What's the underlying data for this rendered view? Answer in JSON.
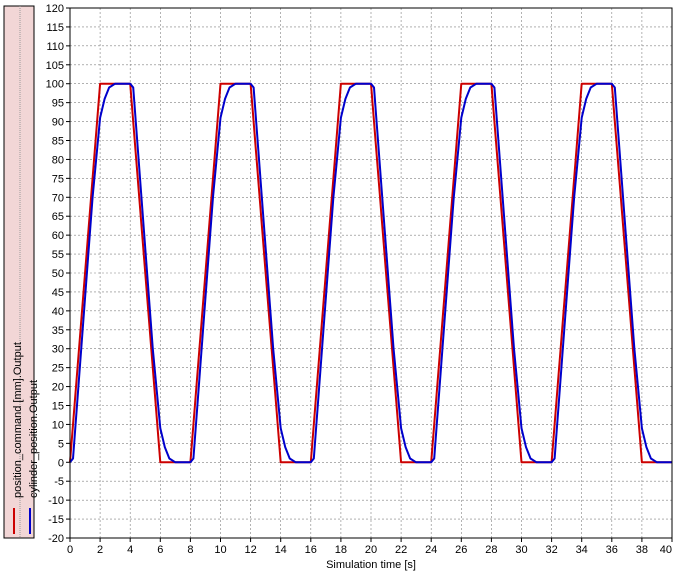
{
  "colors": {
    "legend_bg": "#f2d6d6",
    "plot_bg": "#ffffff",
    "grid": "#808080",
    "series_command": "#cc0000",
    "series_cylinder": "#0000cc"
  },
  "chart_data": {
    "type": "line",
    "title": "",
    "xlabel": "Simulation time [s]",
    "ylabel": "",
    "xlim": [
      0,
      40
    ],
    "ylim": [
      -20,
      120
    ],
    "x_ticks": [
      0,
      2,
      4,
      6,
      8,
      10,
      12,
      14,
      16,
      18,
      20,
      22,
      24,
      26,
      28,
      30,
      32,
      34,
      36,
      38,
      40
    ],
    "y_ticks": [
      -20,
      -15,
      -10,
      -5,
      0,
      5,
      10,
      15,
      20,
      25,
      30,
      35,
      40,
      45,
      50,
      55,
      60,
      65,
      70,
      75,
      80,
      85,
      90,
      95,
      100,
      105,
      110,
      115,
      120
    ],
    "grid": true,
    "legend_placement": "left-vertical",
    "series": [
      {
        "name": "position_command [mm].Output",
        "color": "#cc0000",
        "x": [
          0,
          2,
          4,
          6,
          8,
          10,
          12,
          14,
          16,
          18,
          20,
          22,
          24,
          26,
          28,
          30,
          32,
          34,
          36,
          38,
          40
        ],
        "y": [
          0,
          100,
          100,
          0,
          0,
          100,
          100,
          0,
          0,
          100,
          100,
          0,
          0,
          100,
          100,
          0,
          0,
          100,
          100,
          0,
          0
        ]
      },
      {
        "name": "cylinder_position.Output",
        "color": "#0000cc",
        "x": [
          0,
          0.2,
          1.5,
          2.0,
          2.3,
          2.6,
          3.0,
          4.0,
          4.2,
          5.5,
          6.0,
          6.3,
          6.6,
          7.0,
          8.0,
          8.2,
          9.5,
          10.0,
          10.3,
          10.6,
          11.0,
          12.0,
          12.2,
          13.5,
          14.0,
          14.3,
          14.6,
          15.0,
          16.0,
          16.2,
          17.5,
          18.0,
          18.3,
          18.6,
          19.0,
          20.0,
          20.2,
          21.5,
          22.0,
          22.3,
          22.6,
          23.0,
          24.0,
          24.2,
          25.5,
          26.0,
          26.3,
          26.6,
          27.0,
          28.0,
          28.2,
          29.5,
          30.0,
          30.3,
          30.6,
          31.0,
          32.0,
          32.2,
          33.5,
          34.0,
          34.3,
          34.6,
          35.0,
          36.0,
          36.2,
          37.5,
          38.0,
          38.3,
          38.6,
          39.0,
          40.0
        ],
        "y": [
          0,
          1,
          70,
          91,
          96,
          99,
          100,
          100,
          99,
          30,
          9,
          4,
          1,
          0,
          0,
          1,
          70,
          91,
          96,
          99,
          100,
          100,
          99,
          30,
          9,
          4,
          1,
          0,
          0,
          1,
          70,
          91,
          96,
          99,
          100,
          100,
          99,
          30,
          9,
          4,
          1,
          0,
          0,
          1,
          70,
          91,
          96,
          99,
          100,
          100,
          99,
          30,
          9,
          4,
          1,
          0,
          0,
          1,
          70,
          91,
          96,
          99,
          100,
          100,
          99,
          30,
          9,
          4,
          1,
          0,
          0
        ]
      }
    ]
  }
}
